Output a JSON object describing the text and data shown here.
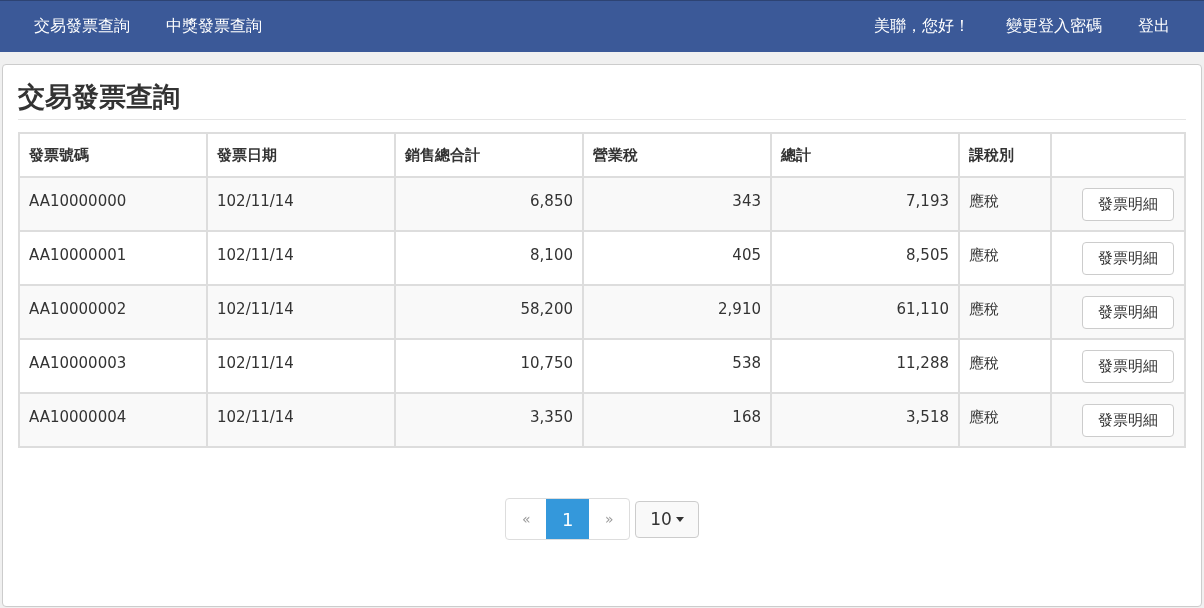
{
  "navbar": {
    "left_links": [
      "交易發票查詢",
      "中獎發票查詢"
    ],
    "greeting": "美聯，您好！",
    "right_links": [
      "變更登入密碼",
      "登出"
    ]
  },
  "page_title": "交易發票查詢",
  "table": {
    "columns": [
      "發票號碼",
      "發票日期",
      "銷售總合計",
      "營業稅",
      "總計",
      "課稅別"
    ],
    "rows": [
      {
        "cells": [
          "AA10000000",
          "102/11/14",
          "6,850",
          "343",
          "7,193",
          "應稅"
        ],
        "action": "發票明細"
      },
      {
        "cells": [
          "AA10000001",
          "102/11/14",
          "8,100",
          "405",
          "8,505",
          "應稅"
        ],
        "action": "發票明細"
      },
      {
        "cells": [
          "AA10000002",
          "102/11/14",
          "58,200",
          "2,910",
          "61,110",
          "應稅"
        ],
        "action": "發票明細"
      },
      {
        "cells": [
          "AA10000003",
          "102/11/14",
          "10,750",
          "538",
          "11,288",
          "應稅"
        ],
        "action": "發票明細"
      },
      {
        "cells": [
          "AA10000004",
          "102/11/14",
          "3,350",
          "168",
          "3,518",
          "應稅"
        ],
        "action": "發票明細"
      }
    ]
  },
  "pagination": {
    "prev": "«",
    "pages": [
      {
        "label": "1",
        "selected": true
      }
    ],
    "next": "»",
    "page_size": "10"
  }
}
